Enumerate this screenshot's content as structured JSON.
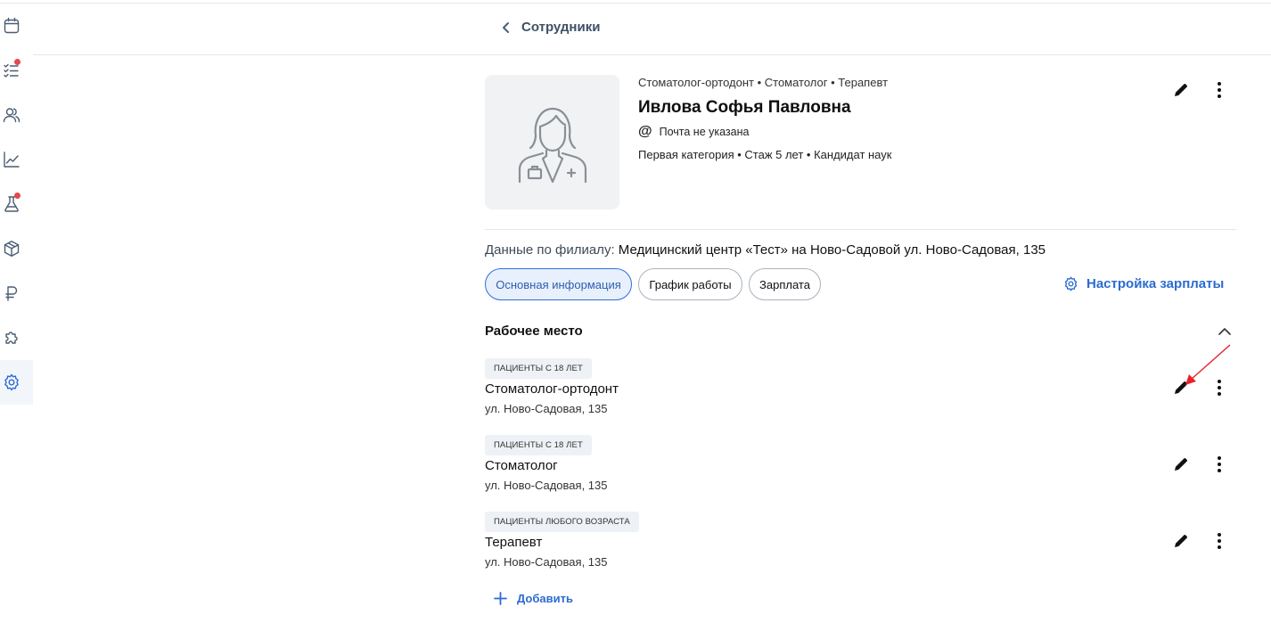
{
  "header": {
    "back_label": "Сотрудники"
  },
  "sidebar": {
    "items": [
      {
        "icon": "calendar-icon",
        "badge": false,
        "active": false
      },
      {
        "icon": "task-list-icon",
        "badge": true,
        "active": false
      },
      {
        "icon": "users-icon",
        "badge": false,
        "active": false
      },
      {
        "icon": "chart-icon",
        "badge": false,
        "active": false
      },
      {
        "icon": "flask-icon",
        "badge": true,
        "active": false
      },
      {
        "icon": "box-icon",
        "badge": false,
        "active": false
      },
      {
        "icon": "ruble-icon",
        "badge": false,
        "active": false
      },
      {
        "icon": "puzzle-icon",
        "badge": false,
        "active": false
      },
      {
        "icon": "gear-icon",
        "badge": false,
        "active": true
      }
    ]
  },
  "profile": {
    "specialties": "Стоматолог-ортодонт • Стоматолог • Терапевт",
    "name": "Ивлова Софья Павловна",
    "email": "Почта не указана",
    "meta": "Первая категория • Стаж 5 лет • Кандидат наук"
  },
  "branch": {
    "label": "Данные по филиалу:",
    "value": "Медицинский центр «Тест» на Ново-Садовой ул. Ново-Садовая, 135"
  },
  "tabs": [
    {
      "label": "Основная информация",
      "active": true
    },
    {
      "label": "График работы",
      "active": false
    },
    {
      "label": "Зарплата",
      "active": false
    }
  ],
  "salary_settings_label": "Настройка зарплаты",
  "workplace": {
    "title": "Рабочее место",
    "items": [
      {
        "badge": "ПАЦИЕНТЫ С 18 ЛЕТ",
        "title": "Стоматолог-ортодонт",
        "address": "ул. Ново-Садовая, 135"
      },
      {
        "badge": "ПАЦИЕНТЫ С 18 ЛЕТ",
        "title": "Стоматолог",
        "address": "ул. Ново-Садовая, 135"
      },
      {
        "badge": "ПАЦИЕНТЫ ЛЮБОГО ВОЗРАСТА",
        "title": "Терапевт",
        "address": "ул. Ново-Садовая, 135"
      }
    ],
    "add_label": "Добавить"
  },
  "colors": {
    "accent": "#2b6bd1",
    "badge_dot": "#e5484d",
    "annotation": "#e8202a"
  }
}
